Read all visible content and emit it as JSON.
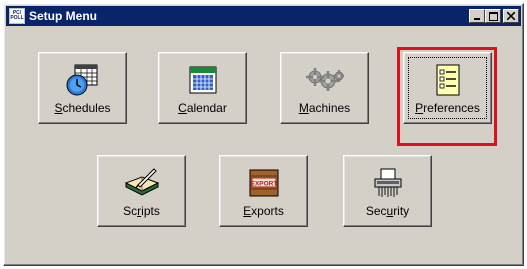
{
  "window": {
    "title": "Setup Menu",
    "icon_text_line1": "PC/",
    "icon_text_line2": "POLL"
  },
  "buttons_row1": [
    {
      "label_pre": "",
      "label_accel": "S",
      "label_post": "chedules",
      "icon": "clock-calendar-icon"
    },
    {
      "label_pre": "",
      "label_accel": "C",
      "label_post": "alendar",
      "icon": "calendar-icon"
    },
    {
      "label_pre": "",
      "label_accel": "M",
      "label_post": "achines",
      "icon": "gears-icon"
    },
    {
      "label_pre": "",
      "label_accel": "P",
      "label_post": "references",
      "icon": "checklist-icon"
    }
  ],
  "buttons_row2": [
    {
      "label_pre": "Sc",
      "label_accel": "r",
      "label_post": "ipts",
      "icon": "book-quill-icon"
    },
    {
      "label_pre": "",
      "label_accel": "E",
      "label_post": "xports",
      "icon": "export-crate-icon"
    },
    {
      "label_pre": "Sec",
      "label_accel": "u",
      "label_post": "rity",
      "icon": "shredder-icon"
    }
  ],
  "export_stamp": "EXPORT",
  "colors": {
    "titlebar": "#0a246a",
    "face": "#d4d0c8",
    "highlight": "#e0101a"
  }
}
